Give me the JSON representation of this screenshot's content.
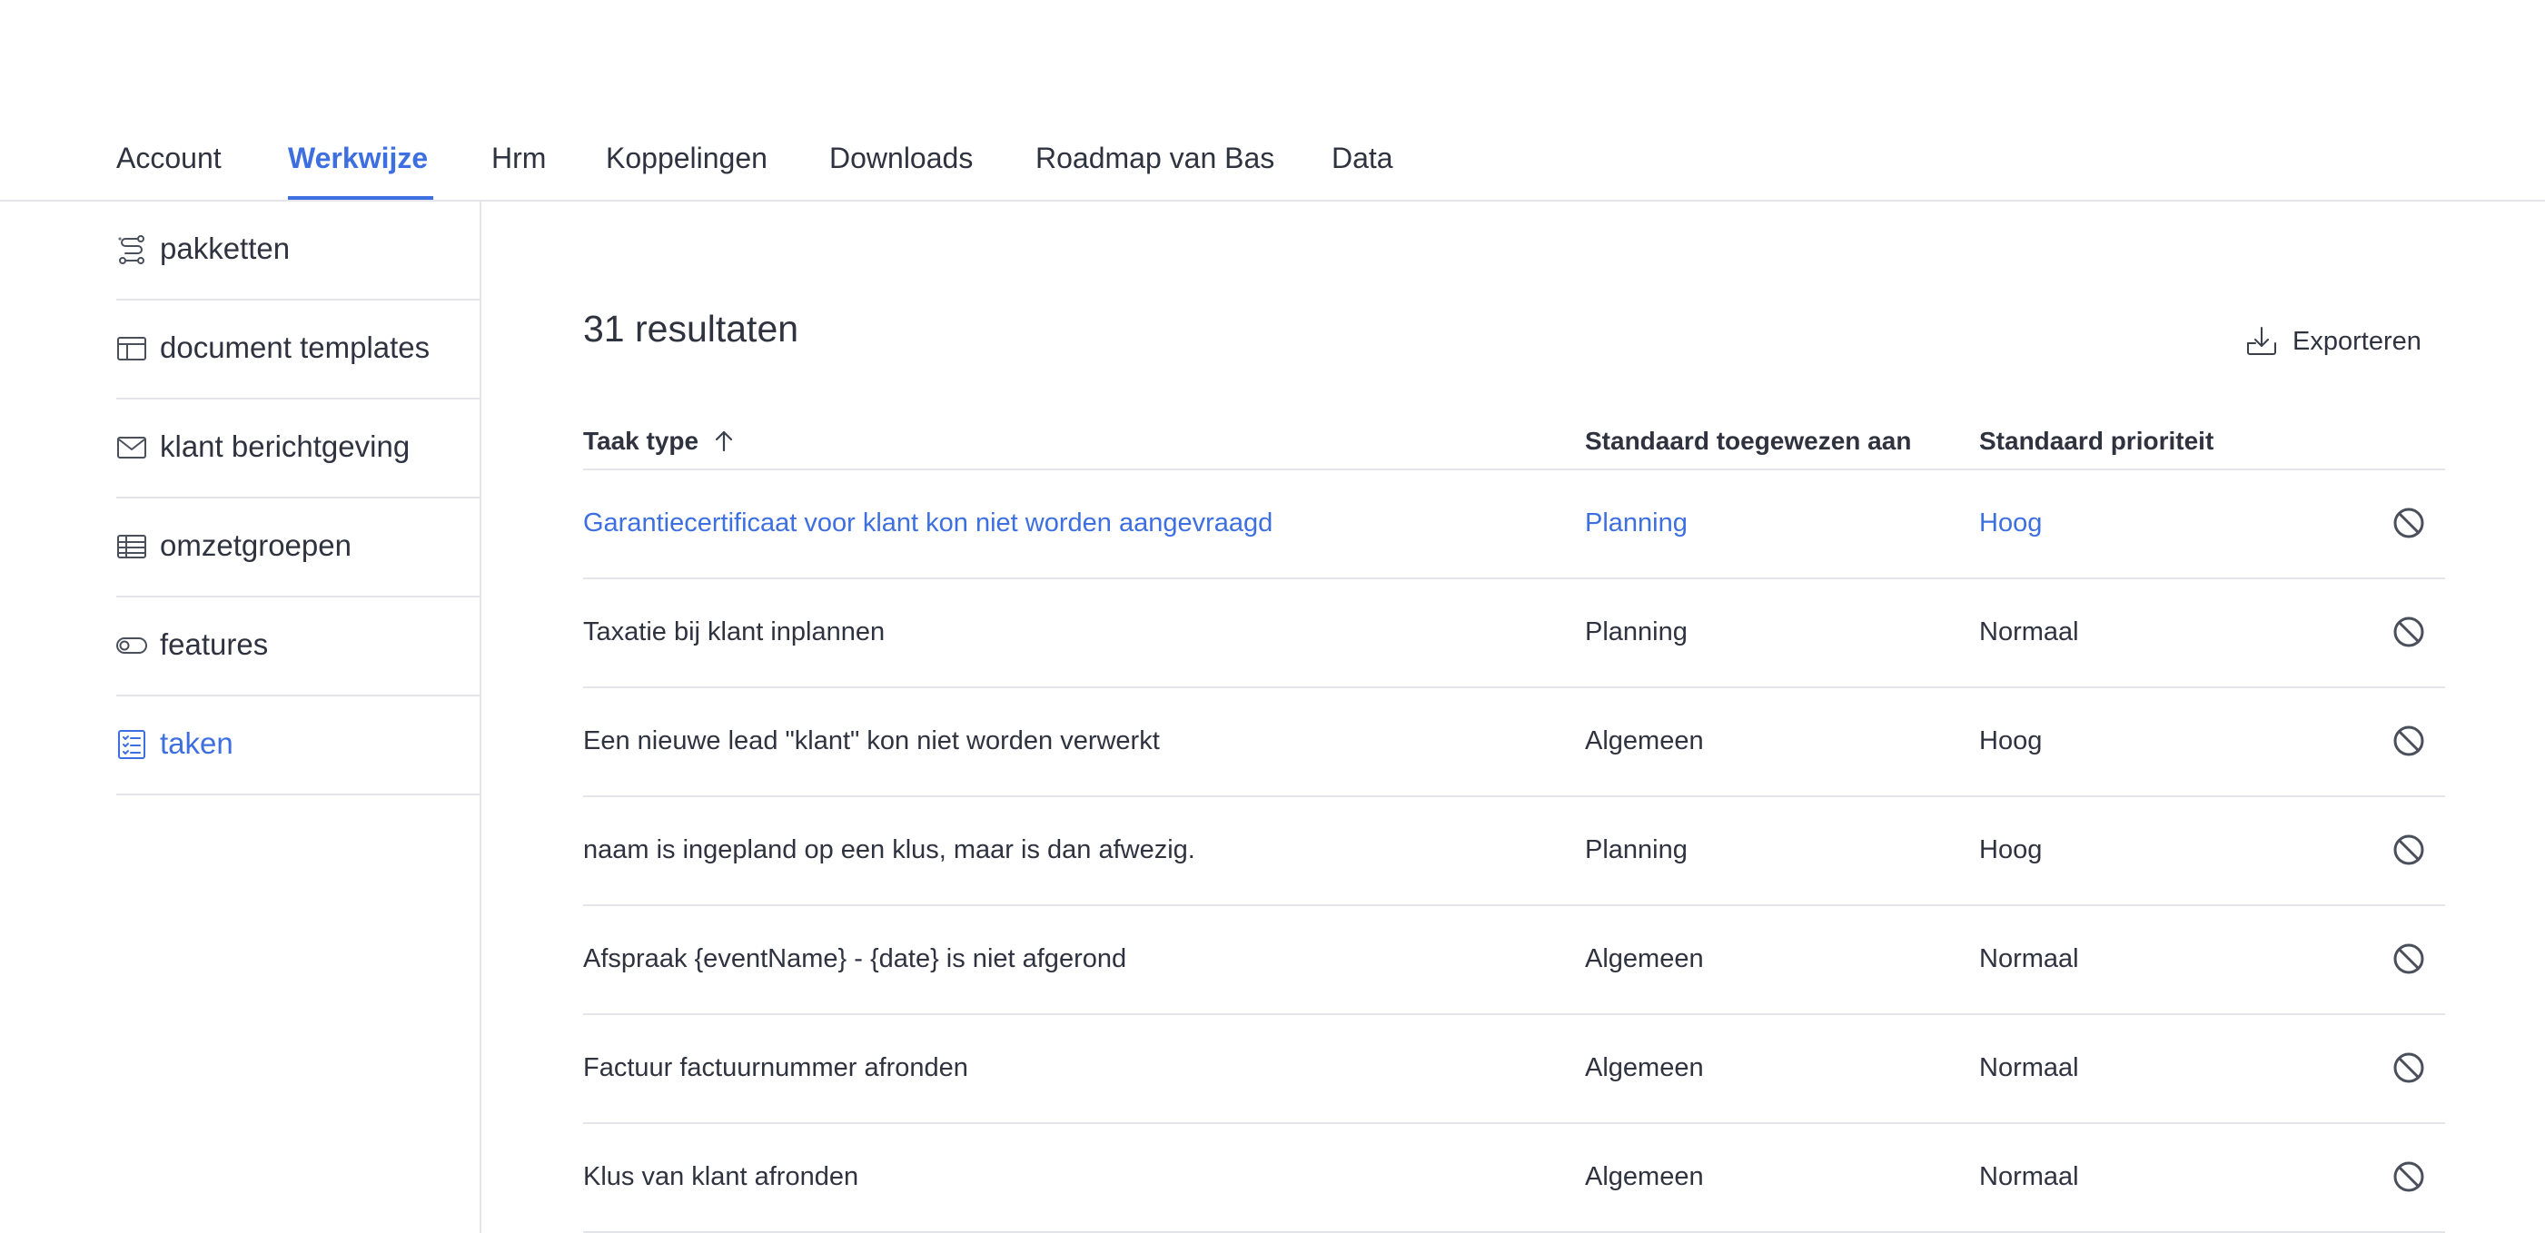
{
  "tabs": [
    {
      "label": "Account"
    },
    {
      "label": "Werkwijze",
      "active": true
    },
    {
      "label": "Hrm"
    },
    {
      "label": "Koppelingen"
    },
    {
      "label": "Downloads"
    },
    {
      "label": "Roadmap van Bas"
    },
    {
      "label": "Data"
    }
  ],
  "sidebar": {
    "items": [
      {
        "label": "pakketten",
        "icon": "route-icon"
      },
      {
        "label": "document templates",
        "icon": "layout-icon"
      },
      {
        "label": "klant berichtgeving",
        "icon": "mail-icon"
      },
      {
        "label": "omzetgroepen",
        "icon": "table-icon"
      },
      {
        "label": "features",
        "icon": "toggle-icon"
      },
      {
        "label": "taken",
        "icon": "checklist-icon",
        "active": true
      }
    ]
  },
  "main": {
    "results_label": "31 resultaten",
    "export_label": "Exporteren",
    "columns": {
      "task_type": "Taak type",
      "assigned": "Standaard toegewezen aan",
      "priority": "Standaard prioriteit"
    },
    "rows": [
      {
        "task": "Garantiecertificaat voor klant kon niet worden aangevraagd",
        "assigned": "Planning",
        "priority": "Hoog"
      },
      {
        "task": "Taxatie bij klant inplannen",
        "assigned": "Planning",
        "priority": "Normaal"
      },
      {
        "task": "Een nieuwe lead \"klant\" kon niet worden verwerkt",
        "assigned": "Algemeen",
        "priority": "Hoog"
      },
      {
        "task": "naam is ingepland op een klus, maar is dan afwezig.",
        "assigned": "Planning",
        "priority": "Hoog"
      },
      {
        "task": "Afspraak {eventName} - {date} is niet afgerond",
        "assigned": "Algemeen",
        "priority": "Normaal"
      },
      {
        "task": "Factuur factuurnummer afronden",
        "assigned": "Algemeen",
        "priority": "Normaal"
      },
      {
        "task": "Klus van klant afronden",
        "assigned": "Algemeen",
        "priority": "Normaal"
      }
    ]
  },
  "colors": {
    "accent": "#3d6fe0",
    "text": "#2f3340",
    "divider": "#e3e5ea"
  }
}
